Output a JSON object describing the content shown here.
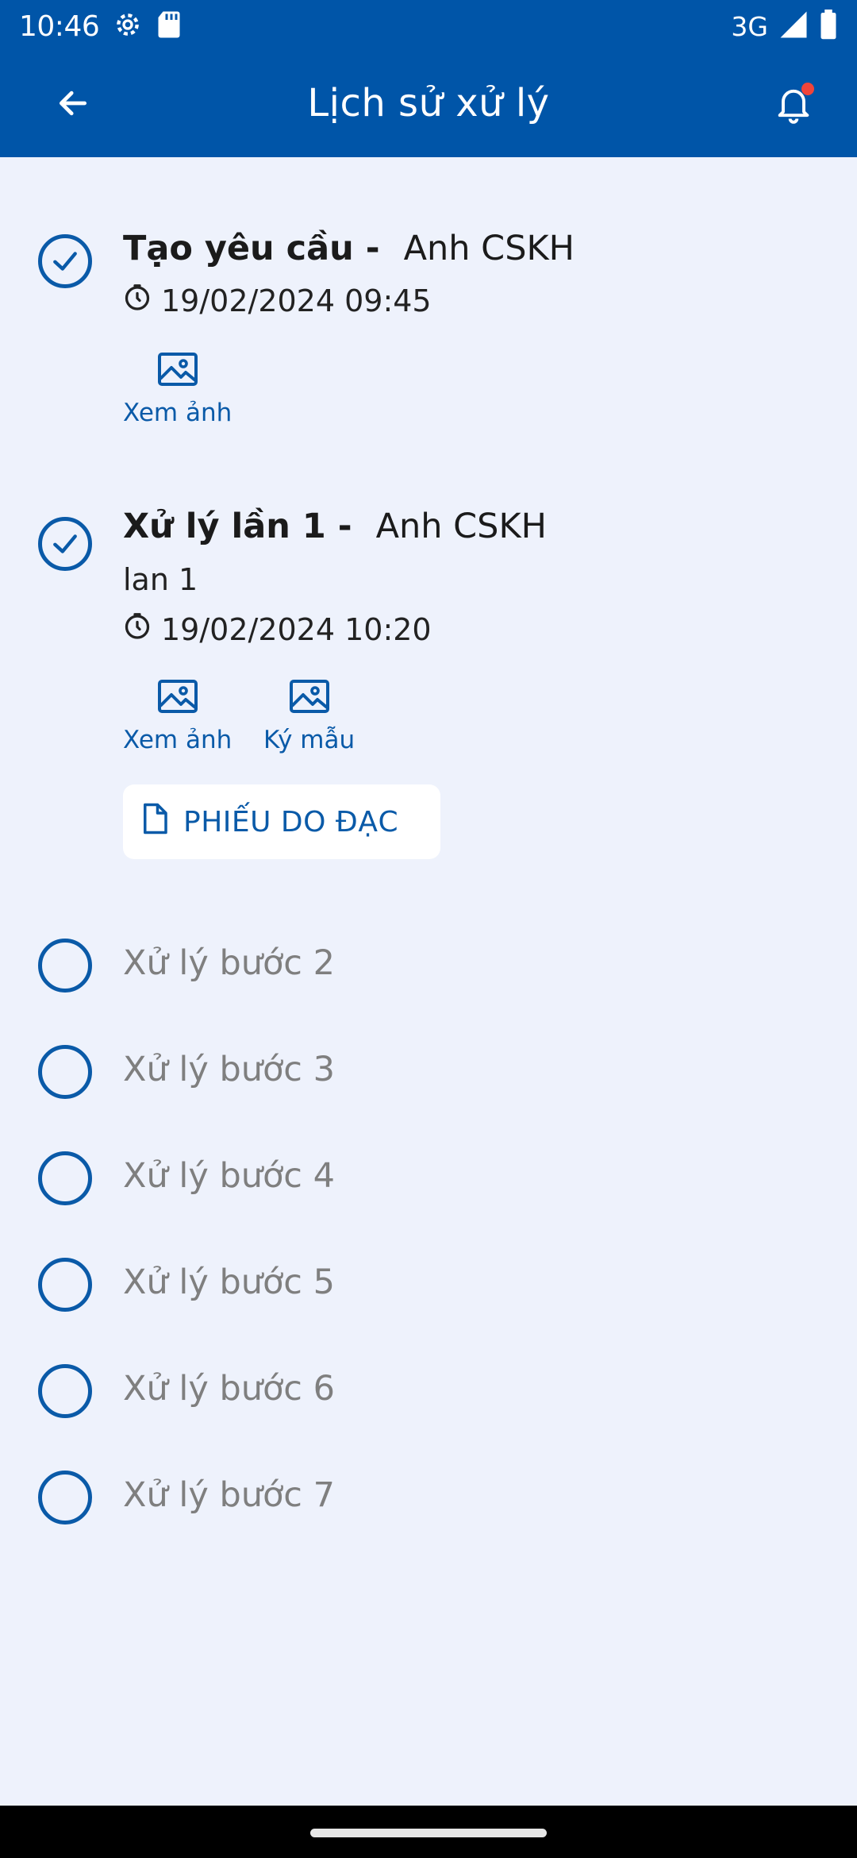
{
  "status_bar": {
    "time": "10:46",
    "network": "3G"
  },
  "app_bar": {
    "title": "Lịch sử xử lý"
  },
  "steps_done": [
    {
      "title": "Tạo yêu cầu -",
      "actor": "Anh  CSKH",
      "timestamp": "19/02/2024 09:45",
      "actions": [
        "Xem ảnh"
      ]
    },
    {
      "title": "Xử lý lần 1 -",
      "actor": "Anh  CSKH",
      "note": "lan 1",
      "timestamp": "19/02/2024 10:20",
      "actions": [
        "Xem ảnh",
        "Ký mẫu"
      ],
      "document_button": "PHIẾU DO ĐẠC"
    }
  ],
  "steps_pending": [
    "Xử lý bước 2",
    "Xử lý bước 3",
    "Xử lý bước 4",
    "Xử lý bước 5",
    "Xử lý bước 6",
    "Xử lý bước 7"
  ],
  "colors": {
    "primary": "#0055a8",
    "accent": "#0a5aa8",
    "background": "#eef2fc",
    "badge": "#f0443a",
    "pending_text": "#7f7f7f"
  }
}
